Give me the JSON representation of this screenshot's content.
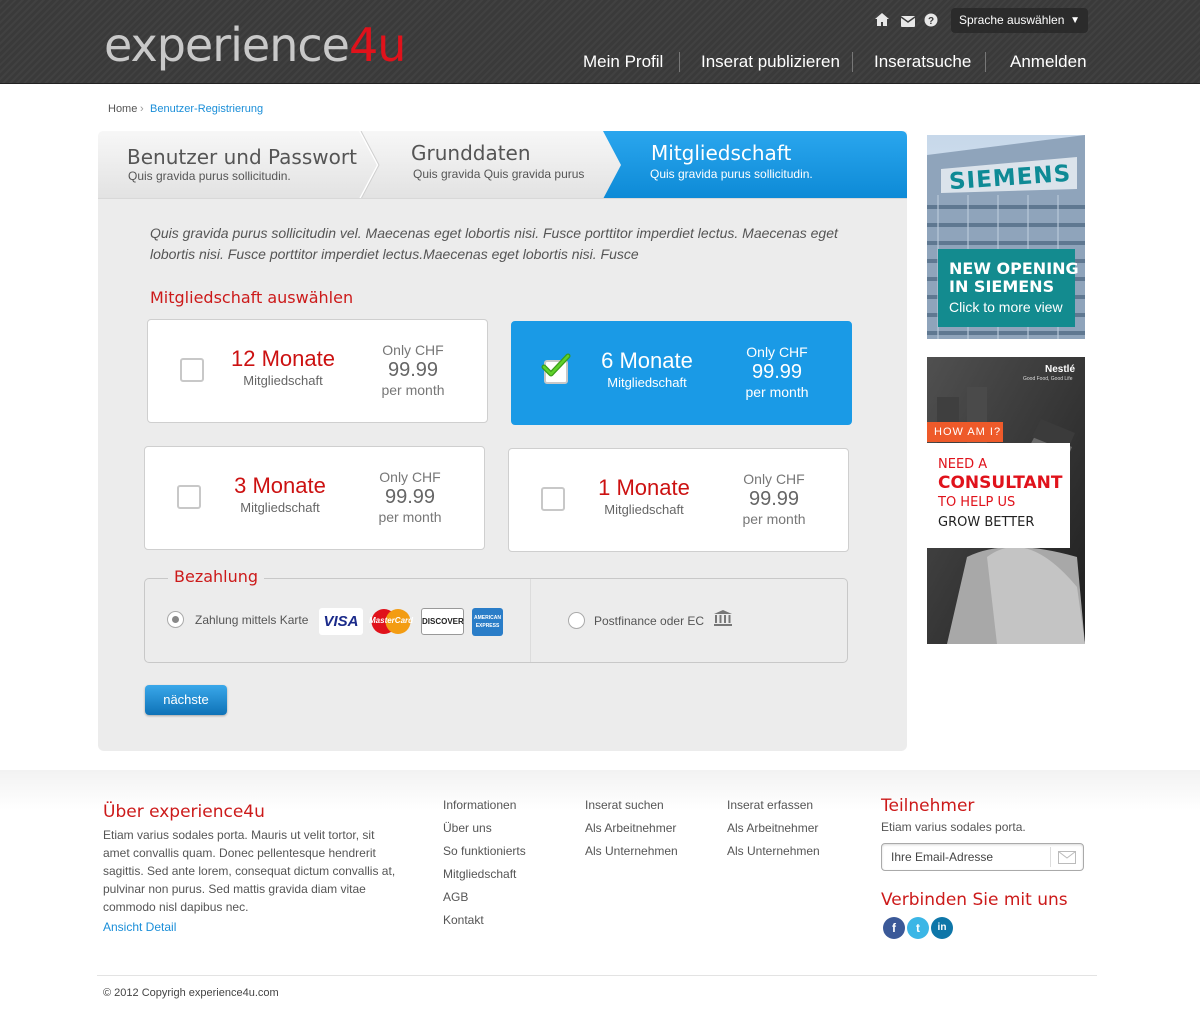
{
  "header": {
    "logo_part1": "experience",
    "logo_part2": "4u",
    "language_select": "Sprache auswählen",
    "nav": [
      "Mein Profil",
      "Inserat publizieren",
      "Inseratsuche",
      "Anmelden"
    ]
  },
  "breadcrumb": {
    "home": "Home",
    "current": "Benutzer-Registrierung"
  },
  "steps": [
    {
      "title": "Benutzer und Passwort",
      "subtitle": "Quis gravida purus sollicitudin."
    },
    {
      "title": "Grunddaten",
      "subtitle": "Quis gravida Quis gravida purus"
    },
    {
      "title": "Mitgliedschaft",
      "subtitle": "Quis gravida purus sollicitudin.",
      "active": true
    }
  ],
  "intro": "Quis gravida purus sollicitudin vel. Maecenas eget lobortis nisi. Fusce porttitor imperdiet lectus. Maecenas eget lobortis nisi. Fusce porttitor imperdiet lectus.Maecenas eget lobortis nisi. Fusce",
  "membership_heading": "Mitgliedschaft auswählen",
  "plans": [
    {
      "name": "12 Monate",
      "type": "Mitgliedschaft",
      "price_prefix": "Only CHF",
      "price": "99.99",
      "price_suffix": "per month",
      "selected": false
    },
    {
      "name": "6 Monate",
      "type": "Mitgliedschaft",
      "price_prefix": "Only CHF",
      "price": "99.99",
      "price_suffix": "per month",
      "selected": true
    },
    {
      "name": "3 Monate",
      "type": "Mitgliedschaft",
      "price_prefix": "Only CHF",
      "price": "99.99",
      "price_suffix": "per month",
      "selected": false
    },
    {
      "name": "1 Monate",
      "type": "Mitgliedschaft",
      "price_prefix": "Only CHF",
      "price": "99.99",
      "price_suffix": "per month",
      "selected": false
    }
  ],
  "payment": {
    "legend": "Bezahlung",
    "card_option": "Zahlung mittels Karte",
    "card_brands": [
      "VISA",
      "MasterCard",
      "DISCOVER",
      "AMERICAN EXPRESS"
    ],
    "alt_option": "Postfinance oder EC",
    "selected": "card"
  },
  "next_button": "nächste",
  "ads": [
    {
      "brand": "SIEMENS",
      "line1": "NEW OPENING",
      "line2": "IN SIEMENS",
      "line3": "Click to more view"
    },
    {
      "brand": "Nestlé",
      "tagline": "Good Food, Good Life",
      "tag": "HOW AM I?",
      "line1": "NEED A",
      "line2": "CONSULTANT",
      "line3": "TO HELP US",
      "line4": "GROW BETTER"
    }
  ],
  "footer": {
    "about_title": "Über experience4u",
    "about_text": "Etiam varius sodales porta. Mauris ut velit tortor, sit amet convallis quam. Donec pellentesque hendrerit sagittis. Sed ante lorem, consequat dictum convallis at, pulvinar non purus. Sed mattis gravida diam vitae commodo nisl dapibus nec.",
    "about_link": "Ansicht Detail",
    "col1": [
      "Informationen",
      "Über uns",
      "So funktionierts",
      "Mitgliedschaft",
      "AGB",
      "Kontakt"
    ],
    "col2": [
      "Inserat suchen",
      "Als Arbeitnehmer",
      "Als Unternehmen"
    ],
    "col3": [
      "Inserat erfassen",
      "Als Arbeitnehmer",
      "Als Unternehmen"
    ],
    "participants_title": "Teilnehmer",
    "participants_text": "Etiam varius sodales porta.",
    "email_placeholder": "Ihre Email-Adresse",
    "connect_title": "Verbinden Sie mit uns",
    "social": [
      "facebook-icon",
      "twitter-icon",
      "linkedin-icon"
    ],
    "copyright": "© 2012 Copyrigh experience4u.com"
  }
}
